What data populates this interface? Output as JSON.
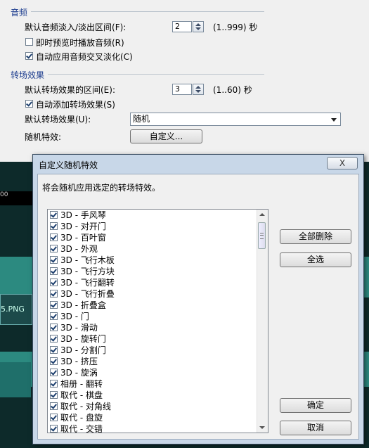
{
  "audio_section": {
    "title": "音频",
    "fade_label": "默认音频淡入/淡出区间(F):",
    "fade_value": "2",
    "fade_range": "(1..999) 秒",
    "preview_label": "即时预览时播放音频(R)",
    "preview_checked": false,
    "crossfade_label": "自动应用音频交叉淡化(C)",
    "crossfade_checked": true
  },
  "transition_section": {
    "title": "转场效果",
    "duration_label": "默认转场效果的区间(E):",
    "duration_value": "3",
    "duration_range": "(1..60) 秒",
    "auto_add_label": "自动添加转场效果(S)",
    "auto_add_checked": true,
    "default_label": "默认转场效果(U):",
    "default_value": "随机",
    "random_label": "随机特效:",
    "custom_button": "自定义..."
  },
  "timeline": {
    "ruler_text": "00",
    "clip_label": "5.PNG"
  },
  "modal": {
    "title": "自定义随机特效",
    "close_label": "X",
    "description": "将会随机应用选定的转场特效。",
    "delete_all_button": "全部删除",
    "select_all_button": "全选",
    "ok_button": "确定",
    "cancel_button": "取消",
    "items": [
      {
        "label": "3D - 手风琴",
        "checked": true
      },
      {
        "label": "3D - 对开门",
        "checked": true
      },
      {
        "label": "3D - 百叶窗",
        "checked": true
      },
      {
        "label": "3D - 外观",
        "checked": true
      },
      {
        "label": "3D - 飞行木板",
        "checked": true
      },
      {
        "label": "3D - 飞行方块",
        "checked": true
      },
      {
        "label": "3D - 飞行翻转",
        "checked": true
      },
      {
        "label": "3D - 飞行折叠",
        "checked": true
      },
      {
        "label": "3D - 折叠盒",
        "checked": true
      },
      {
        "label": "3D - 门",
        "checked": true
      },
      {
        "label": "3D - 滑动",
        "checked": true
      },
      {
        "label": "3D - 旋转门",
        "checked": true
      },
      {
        "label": "3D - 分割门",
        "checked": true
      },
      {
        "label": "3D - 挤压",
        "checked": true
      },
      {
        "label": "3D - 旋涡",
        "checked": true
      },
      {
        "label": "相册 - 翻转",
        "checked": true
      },
      {
        "label": "取代 - 棋盘",
        "checked": true
      },
      {
        "label": "取代 - 对角线",
        "checked": true
      },
      {
        "label": "取代 - 盘旋",
        "checked": true
      },
      {
        "label": "取代 - 交错",
        "checked": true
      }
    ]
  }
}
